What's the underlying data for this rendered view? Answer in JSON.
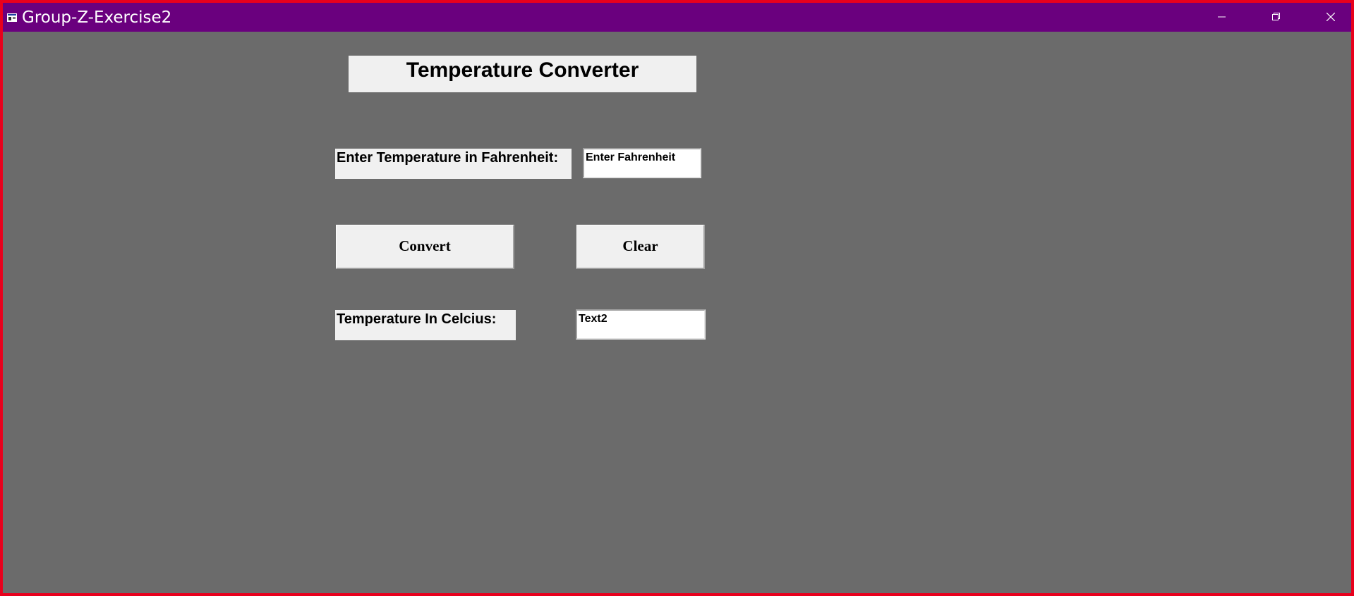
{
  "window": {
    "title": "Group-Z-Exercise2",
    "controls": {
      "minimize_icon": "minimize-icon",
      "maximize_icon": "restore-icon",
      "close_icon": "close-icon"
    }
  },
  "form": {
    "heading": "Temperature Converter",
    "fahrenheit_label": "Enter Temperature in Fahrenheit:",
    "fahrenheit_input_value": "Enter Fahrenheit",
    "convert_button": "Convert",
    "clear_button": "Clear",
    "celcius_label": "Temperature In Celcius:",
    "celcius_output_value": "Text2"
  },
  "colors": {
    "titlebar": "#6a007e",
    "window_border": "#e8001c",
    "client_background": "#6b6b6b",
    "control_face": "#f0f0f0"
  }
}
